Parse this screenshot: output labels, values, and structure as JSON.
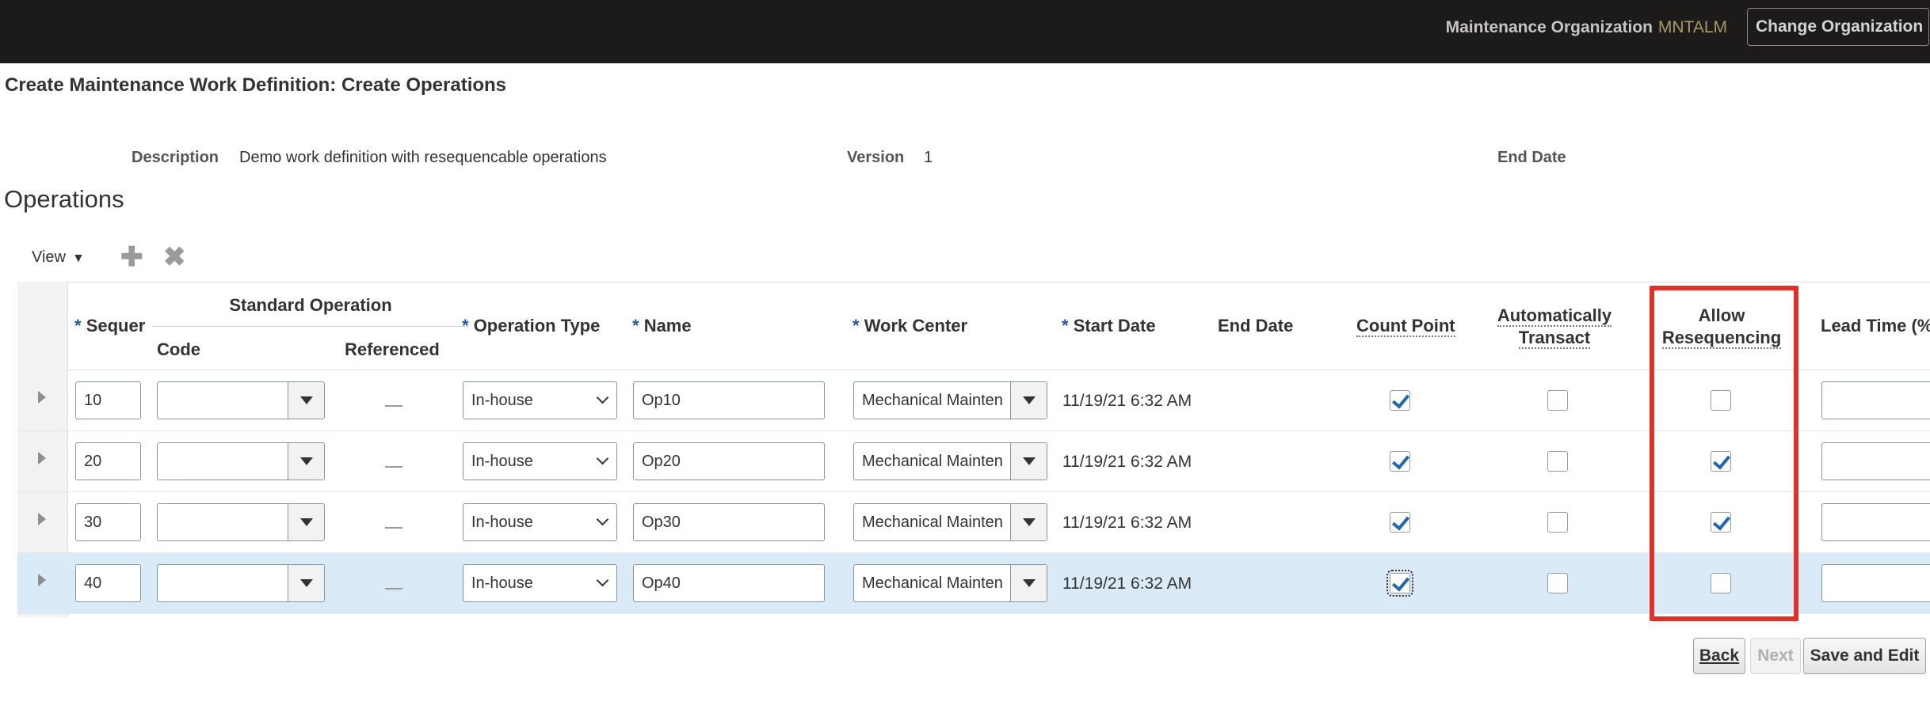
{
  "header": {
    "org_label": "Maintenance Organization",
    "org_value": "MNTALM",
    "change_org_button": "Change Organization"
  },
  "page": {
    "title": "Create Maintenance Work Definition: Create Operations"
  },
  "summary": {
    "description_label": "Description",
    "description_value": "Demo work definition with resequencable operations",
    "version_label": "Version",
    "version_value": "1",
    "end_date_label": "End Date"
  },
  "operations": {
    "section_title": "Operations",
    "toolbar": {
      "view_label": "View",
      "add_icon": "plus-icon",
      "delete_icon": "x-icon"
    },
    "columns": {
      "sequence": "Sequer",
      "standard_operation": "Standard Operation",
      "code": "Code",
      "referenced": "Referenced",
      "operation_type": "Operation Type",
      "name": "Name",
      "work_center": "Work Center",
      "start_date": "Start Date",
      "end_date": "End Date",
      "count_point": "Count Point",
      "auto_transact_1": "Automatically",
      "auto_transact_2": "Transact",
      "allow_reseq_1": "Allow",
      "allow_reseq_2": "Resequencing",
      "lead_time": "Lead Time (%"
    },
    "required_marker": "*",
    "referenced_empty": "—",
    "rows": [
      {
        "sequence": "10",
        "code": "",
        "operation_type": "In-house",
        "name": "Op10",
        "work_center": "Mechanical Mainten",
        "start_date": "11/19/21 6:32 AM",
        "end_date": "",
        "count_point": true,
        "auto_transact": false,
        "allow_resequencing": false,
        "lead_time": ""
      },
      {
        "sequence": "20",
        "code": "",
        "operation_type": "In-house",
        "name": "Op20",
        "work_center": "Mechanical Mainten",
        "start_date": "11/19/21 6:32 AM",
        "end_date": "",
        "count_point": true,
        "auto_transact": false,
        "allow_resequencing": true,
        "lead_time": ""
      },
      {
        "sequence": "30",
        "code": "",
        "operation_type": "In-house",
        "name": "Op30",
        "work_center": "Mechanical Mainten",
        "start_date": "11/19/21 6:32 AM",
        "end_date": "",
        "count_point": true,
        "auto_transact": false,
        "allow_resequencing": true,
        "lead_time": ""
      },
      {
        "sequence": "40",
        "code": "",
        "operation_type": "In-house",
        "name": "Op40",
        "work_center": "Mechanical Mainten",
        "start_date": "11/19/21 6:32 AM",
        "end_date": "",
        "count_point": true,
        "auto_transact": false,
        "allow_resequencing": false,
        "lead_time": "",
        "selected": true
      }
    ]
  },
  "footer": {
    "back_button": "Back",
    "next_button": "Next",
    "save_edit_button": "Save and Edit"
  },
  "colors": {
    "highlight": "#e0302a",
    "selected_row": "#dbeaf7",
    "checkbox_check": "#1f67b1"
  }
}
